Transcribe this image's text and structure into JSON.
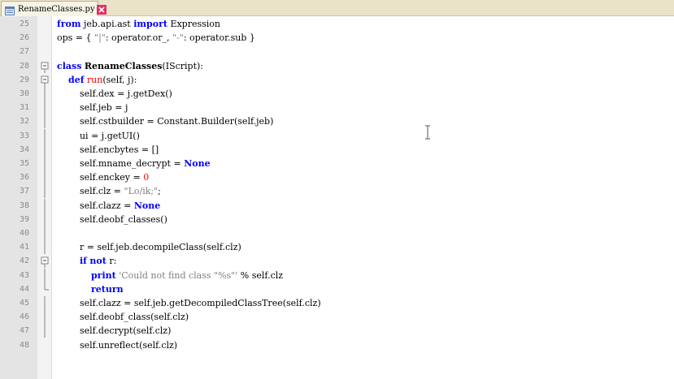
{
  "tab": {
    "label": "RenameClasses.py",
    "icon": "file-icon",
    "close_icon": "close-icon",
    "close_color": "#e0306a"
  },
  "colors": {
    "keyword": "#0000ff",
    "function_name": "#ff0000",
    "string": "#808080",
    "number": "#ff0000",
    "gutter": "#e4e4e4"
  },
  "lines": [
    {
      "num": "25",
      "fold": "",
      "parts": [
        [
          "kw",
          "from"
        ],
        [
          "",
          " jeb.api.ast "
        ],
        [
          "kw",
          "import"
        ],
        [
          "",
          " Expression"
        ]
      ]
    },
    {
      "num": "26",
      "fold": "",
      "parts": [
        [
          "",
          "ops = { "
        ],
        [
          "st",
          "\"|\""
        ],
        [
          "",
          ": operator.or_, "
        ],
        [
          "st",
          "\"-\""
        ],
        [
          "",
          ": operator.sub }"
        ]
      ]
    },
    {
      "num": "27",
      "fold": "",
      "parts": []
    },
    {
      "num": "28",
      "fold": "box",
      "parts": [
        [
          "kw",
          "class"
        ],
        [
          "",
          " "
        ],
        [
          "cls",
          "RenameClasses"
        ],
        [
          "",
          "(IScript):"
        ]
      ]
    },
    {
      "num": "29",
      "fold": "box",
      "parts": [
        [
          "",
          "    "
        ],
        [
          "kw",
          "def"
        ],
        [
          "",
          " "
        ],
        [
          "fn",
          "run"
        ],
        [
          "",
          "(self, j):"
        ]
      ]
    },
    {
      "num": "30",
      "fold": "",
      "parts": [
        [
          "",
          "        self.dex = j.getDex()"
        ]
      ]
    },
    {
      "num": "31",
      "fold": "",
      "parts": [
        [
          "",
          "        self.jeb = j"
        ]
      ]
    },
    {
      "num": "32",
      "fold": "",
      "parts": [
        [
          "",
          "        self.cstbuilder = Constant.Builder(self.jeb)"
        ]
      ]
    },
    {
      "num": "33",
      "fold": "",
      "parts": [
        [
          "",
          "        ui = j.getUI()"
        ]
      ]
    },
    {
      "num": "34",
      "fold": "",
      "parts": [
        [
          "",
          "        self.encbytes = []"
        ]
      ]
    },
    {
      "num": "35",
      "fold": "",
      "parts": [
        [
          "",
          "        self.mname_decrypt = "
        ],
        [
          "kw",
          "None"
        ]
      ]
    },
    {
      "num": "36",
      "fold": "",
      "parts": [
        [
          "",
          "        self.enckey = "
        ],
        [
          "nm",
          "0"
        ]
      ]
    },
    {
      "num": "37",
      "fold": "",
      "parts": [
        [
          "",
          "        self.clz = "
        ],
        [
          "st",
          "\"Lo/ik;\""
        ],
        [
          "",
          ";"
        ]
      ]
    },
    {
      "num": "38",
      "fold": "",
      "parts": [
        [
          "",
          "        self.clazz = "
        ],
        [
          "kw",
          "None"
        ]
      ]
    },
    {
      "num": "39",
      "fold": "",
      "parts": [
        [
          "",
          "        self.deobf_classes()"
        ]
      ]
    },
    {
      "num": "40",
      "fold": "",
      "parts": []
    },
    {
      "num": "41",
      "fold": "",
      "parts": [
        [
          "",
          "        r = self.jeb.decompileClass(self.clz)"
        ]
      ]
    },
    {
      "num": "42",
      "fold": "box",
      "parts": [
        [
          "",
          "        "
        ],
        [
          "kw",
          "if"
        ],
        [
          "",
          " "
        ],
        [
          "kw",
          "not"
        ],
        [
          "",
          " r:"
        ]
      ]
    },
    {
      "num": "43",
      "fold": "",
      "parts": [
        [
          "",
          "            "
        ],
        [
          "kw",
          "print"
        ],
        [
          "",
          " "
        ],
        [
          "st",
          "'Could not find class \"%s\"'"
        ],
        [
          "",
          " % self.clz"
        ]
      ]
    },
    {
      "num": "44",
      "fold": "end",
      "parts": [
        [
          "",
          "            "
        ],
        [
          "kw",
          "return"
        ]
      ]
    },
    {
      "num": "45",
      "fold": "",
      "parts": [
        [
          "",
          "        self.clazz = self.jeb.getDecompiledClassTree(self.clz)"
        ]
      ]
    },
    {
      "num": "46",
      "fold": "",
      "parts": [
        [
          "",
          "        self.deobf_class(self.clz)"
        ]
      ]
    },
    {
      "num": "47",
      "fold": "",
      "parts": [
        [
          "",
          "        self.decrypt(self.clz)"
        ]
      ]
    },
    {
      "num": "48",
      "fold": "",
      "parts": [
        [
          "",
          "        self.unreflect(self.clz)"
        ]
      ]
    }
  ]
}
